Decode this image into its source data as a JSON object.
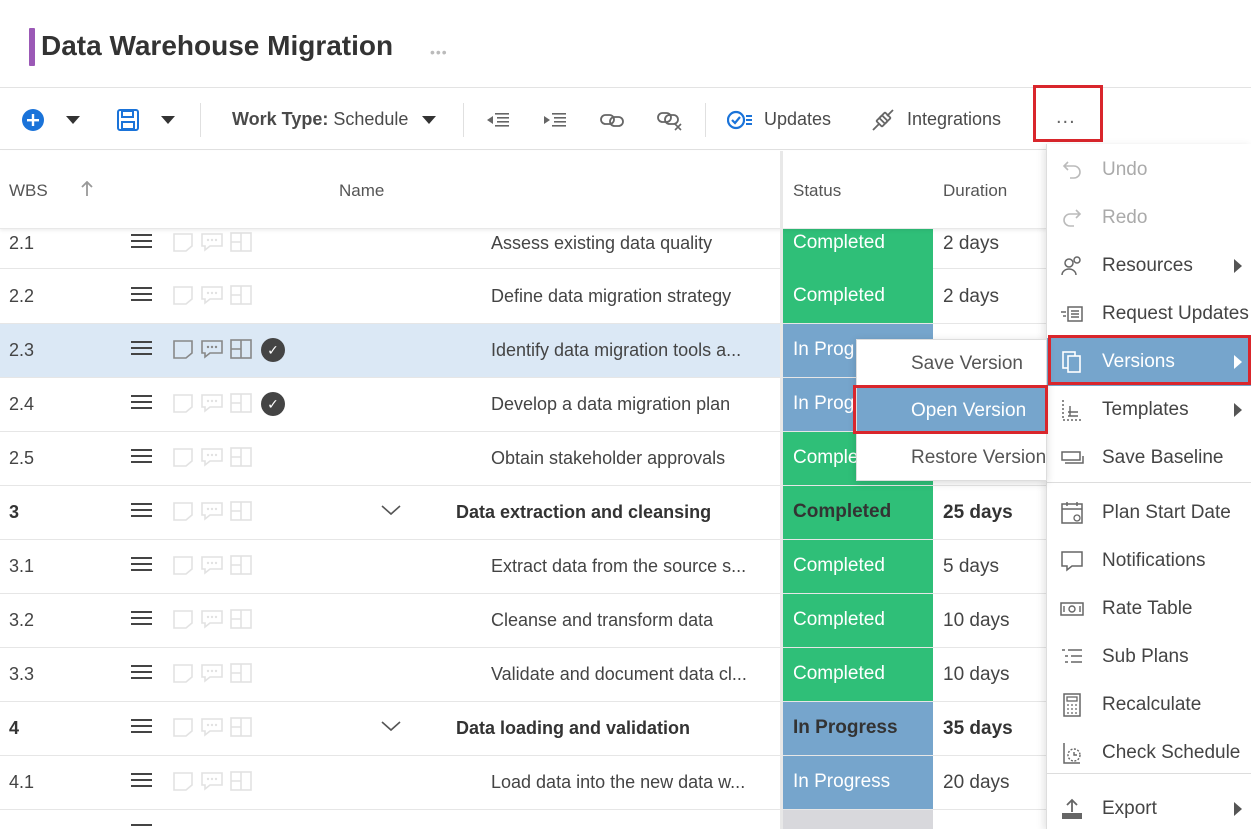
{
  "title": "Data Warehouse Migration",
  "toolbar": {
    "work_type_label": "Work Type:",
    "work_type_value": "Schedule",
    "updates_label": "Updates",
    "integrations_label": "Integrations",
    "more_label": "..."
  },
  "grid": {
    "headers": {
      "wbs": "WBS",
      "name": "Name",
      "status": "Status",
      "duration": "Duration"
    },
    "rows": [
      {
        "wbs": "2.1",
        "name": "Assess existing data quality",
        "status": "Completed",
        "duration": "2 days"
      },
      {
        "wbs": "2.2",
        "name": "Define data migration strategy",
        "status": "Completed",
        "duration": "2 days"
      },
      {
        "wbs": "2.3",
        "name": "Identify data migration tools a...",
        "status": "In Prog",
        "duration": ""
      },
      {
        "wbs": "2.4",
        "name": "Develop a data migration plan",
        "status": "In Prog",
        "duration": ""
      },
      {
        "wbs": "2.5",
        "name": "Obtain stakeholder approvals",
        "status": "Comple",
        "duration": ""
      },
      {
        "wbs": "3",
        "name": "Data extraction and cleansing",
        "status": "Completed",
        "duration": "25 days"
      },
      {
        "wbs": "3.1",
        "name": "Extract data from the source s...",
        "status": "Completed",
        "duration": "5 days"
      },
      {
        "wbs": "3.2",
        "name": "Cleanse and transform data",
        "status": "Completed",
        "duration": "10 days"
      },
      {
        "wbs": "3.3",
        "name": "Validate and document data cl...",
        "status": "Completed",
        "duration": "10 days"
      },
      {
        "wbs": "4",
        "name": "Data loading and validation",
        "status": "In Progress",
        "duration": "35 days"
      },
      {
        "wbs": "4.1",
        "name": "Load data into the new data w...",
        "status": "In Progress",
        "duration": "20 days"
      }
    ]
  },
  "menu": {
    "items": [
      {
        "label": "Undo",
        "icon": "undo-icon"
      },
      {
        "label": "Redo",
        "icon": "redo-icon"
      },
      {
        "label": "Resources",
        "icon": "resources-icon"
      },
      {
        "label": "Request Updates",
        "icon": "request-updates-icon"
      },
      {
        "label": "Versions",
        "icon": "versions-icon"
      },
      {
        "label": "Templates",
        "icon": "templates-icon"
      },
      {
        "label": "Save Baseline",
        "icon": "baseline-icon"
      },
      {
        "label": "Plan Start Date",
        "icon": "calendar-icon"
      },
      {
        "label": "Notifications",
        "icon": "notification-icon"
      },
      {
        "label": "Rate Table",
        "icon": "rate-table-icon"
      },
      {
        "label": "Sub Plans",
        "icon": "sub-plans-icon"
      },
      {
        "label": "Recalculate",
        "icon": "calculator-icon"
      },
      {
        "label": "Check Schedule",
        "icon": "check-schedule-icon"
      },
      {
        "label": "Export",
        "icon": "export-icon"
      }
    ]
  },
  "submenu": {
    "items": [
      {
        "label": "Save Version"
      },
      {
        "label": "Open Version"
      },
      {
        "label": "Restore Version"
      }
    ]
  },
  "colors": {
    "completed": "#2fbf78",
    "in_progress": "#76a5cc",
    "accent": "#1a73d9",
    "title_accent": "#9b59b6",
    "highlight_border": "#d9262c"
  }
}
